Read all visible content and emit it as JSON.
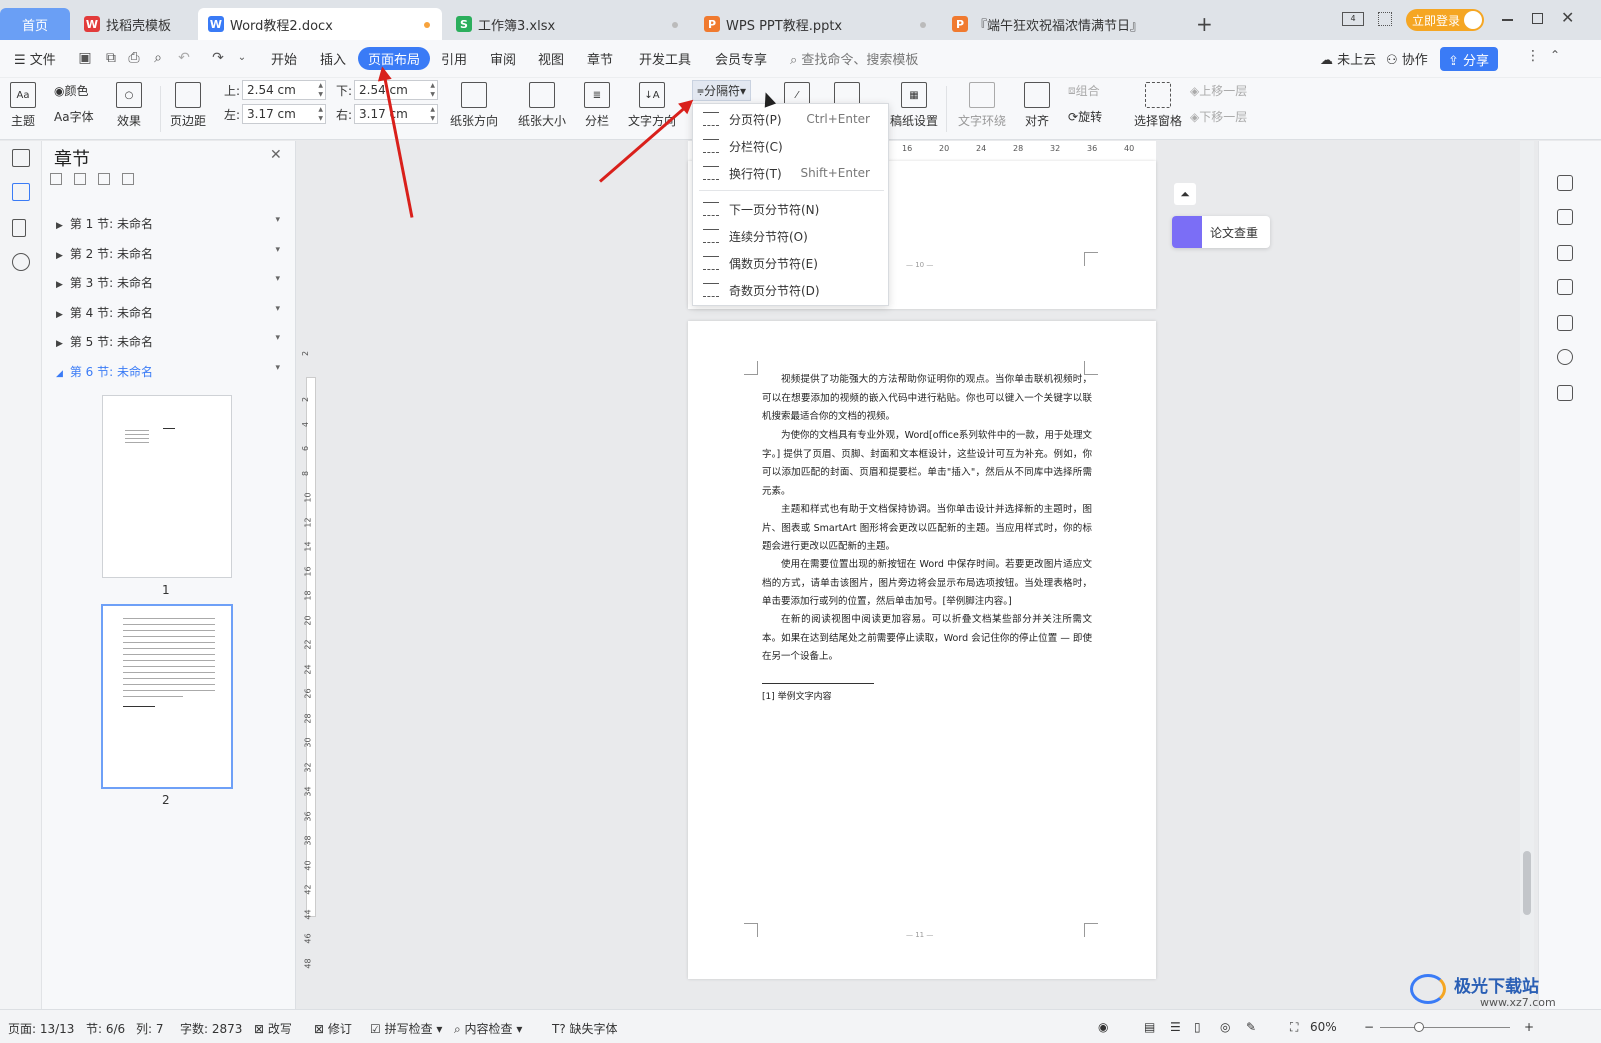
{
  "tabs": {
    "home": "首页",
    "t1": "找稻壳模板",
    "t2": "Word教程2.docx",
    "t3": "工作簿3.xlsx",
    "t4": "WPS PPT教程.pptx",
    "t5": "『端午狂欢祝福浓情满节日』",
    "login": "立即登录"
  },
  "menu": {
    "file": "文件",
    "items": [
      "开始",
      "插入",
      "页面布局",
      "引用",
      "审阅",
      "视图",
      "章节",
      "开发工具",
      "会员专享"
    ],
    "search": "查找命令、搜索模板",
    "cloud": "未上云",
    "collab": "协作",
    "share": "分享"
  },
  "ribbon": {
    "theme": "主题",
    "color": "颜色",
    "font": "字体",
    "effect": "效果",
    "margin": "页边距",
    "top_label": "上:",
    "top_val": "2.54 cm",
    "bottom_label": "下:",
    "bottom_val": "2.54 cm",
    "left_label": "左:",
    "left_val": "3.17 cm",
    "right_label": "右:",
    "right_val": "3.17 cm",
    "orientation": "纸张方向",
    "size": "纸张大小",
    "columns": "分栏",
    "textdir": "文字方向",
    "separator": "分隔符",
    "manuscript": "稿纸设置",
    "wrap": "文字环绕",
    "align": "对齐",
    "group": "组合",
    "rotate": "旋转",
    "selpane": "选择窗格",
    "up": "上移一层",
    "down": "下移一层"
  },
  "panel": {
    "title": "章节",
    "chapters": [
      "第 1 节: 未命名",
      "第 2 节: 未命名",
      "第 3 节: 未命名",
      "第 4 节: 未命名",
      "第 5 节: 未命名",
      "第 6 节: 未命名"
    ],
    "page1": "1",
    "page2": "2"
  },
  "dropdown": {
    "items": [
      {
        "label": "分页符(P)",
        "shortcut": "Ctrl+Enter"
      },
      {
        "label": "分栏符(C)",
        "shortcut": ""
      },
      {
        "label": "换行符(T)",
        "shortcut": "Shift+Enter"
      },
      {
        "label": "下一页分节符(N)",
        "shortcut": ""
      },
      {
        "label": "连续分节符(O)",
        "shortcut": ""
      },
      {
        "label": "偶数页分节符(E)",
        "shortcut": ""
      },
      {
        "label": "奇数页分节符(D)",
        "shortcut": ""
      }
    ]
  },
  "ruler": {
    "h": [
      "16",
      "20",
      "24",
      "28",
      "32",
      "36",
      "40"
    ],
    "v": [
      "2",
      "2",
      "4",
      "6",
      "8",
      "10",
      "12",
      "14",
      "16",
      "18",
      "20",
      "22",
      "24",
      "26",
      "28",
      "30",
      "32",
      "34",
      "36",
      "38",
      "40",
      "42",
      "44",
      "46",
      "48"
    ]
  },
  "side": {
    "paper_check": "论文查重"
  },
  "document": {
    "page_top_num": "— 10 —",
    "page_bottom_num": "— 11 —",
    "paragraphs": [
      "视频提供了功能强大的方法帮助你证明你的观点。当你单击联机视频时，可以在想要添加的视频的嵌入代码中进行粘贴。你也可以键入一个关键字以联机搜索最适合你的文档的视频。",
      "为使你的文档具有专业外观，Word[office系列软件中的一款，用于处理文字。] 提供了页眉、页脚、封面和文本框设计，这些设计可互为补充。例如，你可以添加匹配的封面、页眉和提要栏。单击\"插入\"，然后从不同库中选择所需元素。",
      "主题和样式也有助于文档保持协调。当你单击设计并选择新的主题时，图片、图表或 SmartArt 图形将会更改以匹配新的主题。当应用样式时，你的标题会进行更改以匹配新的主题。",
      "使用在需要位置出现的新按钮在 Word 中保存时间。若要更改图片适应文档的方式，请单击该图片，图片旁边将会显示布局选项按钮。当处理表格时，单击要添加行或列的位置，然后单击加号。[举例脚注内容。]",
      "在新的阅读视图中阅读更加容易。可以折叠文档某些部分并关注所需文本。如果在达到结尾处之前需要停止读取，Word 会记住你的停止位置 — 即使在另一个设备上。"
    ],
    "footnote": "[1] 举例文字内容"
  },
  "status": {
    "page": "页面: 13/13",
    "section": "节: 6/6",
    "col": "列: 7",
    "words": "字数: 2873",
    "rev": "改写",
    "track": "修订",
    "spell": "拼写检查",
    "content": "内容检查",
    "missing_font": "缺失字体",
    "zoom": "60%"
  },
  "watermark": "极光下载站",
  "watermark_url": "www.xz7.com",
  "colors": {
    "accent": "#3a7bf6",
    "arrow": "#d9201b"
  }
}
